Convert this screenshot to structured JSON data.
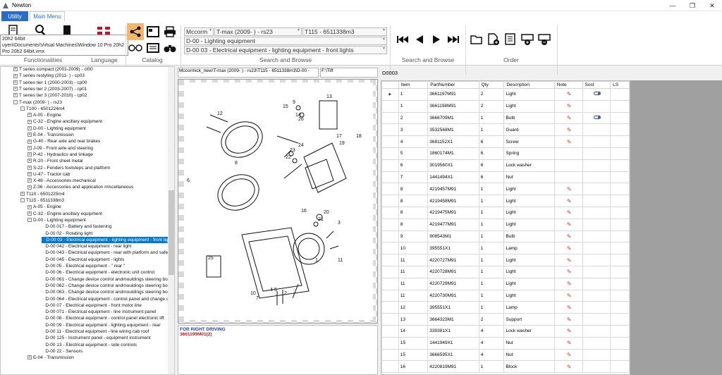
{
  "window": {
    "title": "Newton",
    "controls": [
      "—",
      "❐",
      "✕"
    ]
  },
  "ribbon": {
    "tabs": [
      "Utility",
      "Main Menu"
    ],
    "groups": [
      "Functionalities",
      "Language",
      "Catalog",
      "Search and Browse",
      "Search and Browse",
      "Order"
    ],
    "tooltip_lines": [
      "20h2 64bit",
      "uyen\\Documents\\Virtual Machines\\Window 10 Pro 20h2",
      "Pro 20h2 64bit.vmx"
    ],
    "combos": {
      "brand": "Mccorm",
      "series": "T-max (2009-    ) - rs23",
      "model": "T115 - 6511338m3",
      "group": "D-00 - Lighting equipment",
      "section": "D-00 03 - Electrical equipment - lighting equipment - front lights"
    }
  },
  "tree": {
    "items": [
      {
        "t": "T series compact (2001-2009) - ct00",
        "exp": "+"
      },
      {
        "t": "T series restyling (2011-    ) - cp03",
        "exp": "+"
      },
      {
        "t": "T series tier 1 (2000-2003) - cp00",
        "exp": "+"
      },
      {
        "t": "T series tier 2 (2003-2007) - cp01",
        "exp": "+"
      },
      {
        "t": "T series tier 3 (2007-2010) - cp02",
        "exp": "+"
      },
      {
        "t": "T-max (2009-    ) - rs23",
        "exp": "-"
      },
      {
        "t": "T100 - 6501224m4",
        "exp": "-"
      },
      {
        "t": "A-05 - Engine",
        "exp": "+"
      },
      {
        "t": "C-32 - Engine ancillary equipment",
        "exp": "+"
      },
      {
        "t": "D-00 - Lighting equipment",
        "exp": "+"
      },
      {
        "t": "E-04 - Transmission",
        "exp": "+"
      },
      {
        "t": "G-40 - Rear axle and rear brakes",
        "exp": "+"
      },
      {
        "t": "J-09 - Front axle and steering",
        "exp": "+"
      },
      {
        "t": "P-42 - Hydraulics and linkage",
        "exp": "+"
      },
      {
        "t": "R-20 - Front sheet metal",
        "exp": "+"
      },
      {
        "t": "S-22 - Fenders footsteps and platform",
        "exp": "+"
      },
      {
        "t": "U-47 - Tractor cab",
        "exp": "+"
      },
      {
        "t": "X-48 - Accessories mechanical",
        "exp": "+"
      },
      {
        "t": "Z-36 - Accessories and application miscellaneous",
        "exp": "+"
      },
      {
        "t": "T110 - 6501225m4",
        "exp": "+"
      },
      {
        "t": "T115 - 6511338m3",
        "exp": "-"
      },
      {
        "t": "A-05 - Engine",
        "exp": "+"
      },
      {
        "t": "C-32 - Engine ancillary equipment",
        "exp": "+"
      },
      {
        "t": "D-00 - Lighting equipment",
        "exp": "-"
      },
      {
        "t": "D-00 017 - Battery and fastening",
        "exp": ""
      },
      {
        "t": "D-00 02 - Rotating light",
        "exp": ""
      },
      {
        "t": "D-00 03 - Electrical equipment - lighting equipment - front lights",
        "exp": ""
      },
      {
        "t": "D-00 042 - Electrical equipment - rear light",
        "exp": ""
      },
      {
        "t": "D-00 043 - Electrical equipment - rear with platform and safety",
        "exp": ""
      },
      {
        "t": "D-00 045 - Electrical equipment - lights",
        "exp": ""
      },
      {
        "t": "D-00 05 - Electrical equipment - \" rear \"",
        "exp": ""
      },
      {
        "t": "D-00 06 - Electrical equipment - electronic unit control",
        "exp": ""
      },
      {
        "t": "D-00 061 - Change device control andmouldings steering box -",
        "exp": ""
      },
      {
        "t": "D-00 062 - Change device control andmouldings steering box -",
        "exp": ""
      },
      {
        "t": "D-00 063 - Change device control andmouldings steering box -",
        "exp": ""
      },
      {
        "t": "D-00 064 - Electrical equipment - control panel and  change de",
        "exp": ""
      },
      {
        "t": "D-00 07 - Electrical equipment - front motor line",
        "exp": ""
      },
      {
        "t": "D-00 071 - Electrical equipment - line instrument panel",
        "exp": ""
      },
      {
        "t": "D-00 08 - Electrical equipment - control panel electronic lift",
        "exp": ""
      },
      {
        "t": "D-00 09 - Electrical equipment - lighting equipment - rear",
        "exp": ""
      },
      {
        "t": "D-00 11 - Electrical equipment - line wiring cab roof",
        "exp": ""
      },
      {
        "t": "D-00 125 - Instrument panel - equipment instrument",
        "exp": ""
      },
      {
        "t": "D-00 13 - Electrical equipment - side controls",
        "exp": ""
      },
      {
        "t": "D-00 22 - Sensors",
        "exp": ""
      },
      {
        "t": "E-04 - Transmission",
        "exp": "+"
      }
    ],
    "selected_index": 26
  },
  "path_box": "Mccormick_new\\T-max (2009-   ) - rs23\\T115 - 6511338m3\\D-00 -",
  "path_box2": "F:\\Tiff",
  "drawing_callouts": [
    "15",
    "9",
    "13",
    "12",
    "14",
    "26",
    "8",
    "24",
    "23",
    "22",
    "17",
    "19",
    "18",
    "6",
    "16",
    "21",
    "20",
    "3",
    "1",
    "11",
    "7",
    "25",
    "10",
    "4",
    "5",
    "2"
  ],
  "note": {
    "line1": "FOR RIGHT DRIVING",
    "line2": "3661199M01(2)"
  },
  "grid": {
    "label": "D0003",
    "columns": [
      "Item",
      "PartNumber",
      "Qty",
      "Description",
      "Note",
      "Sost",
      "LS"
    ],
    "rows": [
      {
        "item": "1",
        "part": "3661197M91",
        "qty": "2",
        "desc": "Light",
        "note": true,
        "sost": true
      },
      {
        "item": "1",
        "part": "3661198M91",
        "qty": "2",
        "desc": "Light",
        "note": true,
        "sost": false
      },
      {
        "item": "2",
        "part": "3666709M1",
        "qty": "1",
        "desc": "Bulb",
        "note": true,
        "sost": true
      },
      {
        "item": "3",
        "part": "3532568M1",
        "qty": "1",
        "desc": "Guard",
        "note": true,
        "sost": false
      },
      {
        "item": "4",
        "part": "3681152X1",
        "qty": "6",
        "desc": "Screw",
        "note": true,
        "sost": false
      },
      {
        "item": "5",
        "part": "1860174M1",
        "qty": "6",
        "desc": "Spring",
        "note": false,
        "sost": false
      },
      {
        "item": "6",
        "part": "3019560X1",
        "qty": "6",
        "desc": "Lock washer",
        "note": false,
        "sost": false
      },
      {
        "item": "7",
        "part": "1441494X1",
        "qty": "6",
        "desc": "Nut",
        "note": false,
        "sost": false
      },
      {
        "item": "8",
        "part": "4219457M91",
        "qty": "1",
        "desc": "Light",
        "note": true,
        "sost": false
      },
      {
        "item": "8",
        "part": "4219458M91",
        "qty": "1",
        "desc": "Light",
        "note": true,
        "sost": false
      },
      {
        "item": "8",
        "part": "4219475M91",
        "qty": "1",
        "desc": "Light",
        "note": true,
        "sost": false
      },
      {
        "item": "8",
        "part": "4219477M91",
        "qty": "1",
        "desc": "Light",
        "note": true,
        "sost": false
      },
      {
        "item": "9",
        "part": "908543M1",
        "qty": "1",
        "desc": "Bulb",
        "note": true,
        "sost": false
      },
      {
        "item": "10",
        "part": "395551X1",
        "qty": "1",
        "desc": "Lamp",
        "note": true,
        "sost": false
      },
      {
        "item": "11",
        "part": "4220727M91",
        "qty": "1",
        "desc": "Light",
        "note": true,
        "sost": false
      },
      {
        "item": "11",
        "part": "4220728M91",
        "qty": "1",
        "desc": "Light",
        "note": true,
        "sost": false
      },
      {
        "item": "11",
        "part": "4220729M91",
        "qty": "1",
        "desc": "Light",
        "note": true,
        "sost": false
      },
      {
        "item": "11",
        "part": "4220730M91",
        "qty": "1",
        "desc": "Light",
        "note": true,
        "sost": false
      },
      {
        "item": "12",
        "part": "395551X1",
        "qty": "1",
        "desc": "Lamp",
        "note": true,
        "sost": false
      },
      {
        "item": "13",
        "part": "3664323M1",
        "qty": "2",
        "desc": "Support",
        "note": true,
        "sost": false
      },
      {
        "item": "14",
        "part": "339381X1",
        "qty": "4",
        "desc": "Lock washer",
        "note": true,
        "sost": false
      },
      {
        "item": "15",
        "part": "1441949X1",
        "qty": "4",
        "desc": "Nut",
        "note": true,
        "sost": false
      },
      {
        "item": "15",
        "part": "3666595X1",
        "qty": "4",
        "desc": "Nut",
        "note": true,
        "sost": false
      },
      {
        "item": "16",
        "part": "4220819M91",
        "qty": "1",
        "desc": "Block",
        "note": true,
        "sost": false
      }
    ]
  },
  "colors": {
    "accent": "#2b6cc4",
    "selection": "#0078d7",
    "pen": "#c0392b"
  }
}
